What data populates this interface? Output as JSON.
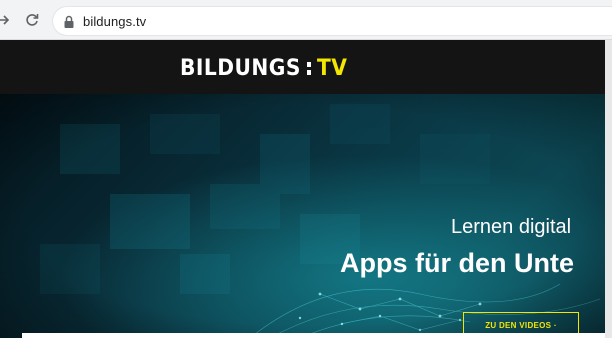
{
  "browser": {
    "url": "bildungs.tv",
    "icons": {
      "forward": "forward-arrow-icon",
      "reload": "reload-icon",
      "lock": "lock-icon"
    }
  },
  "header": {
    "logo_primary": "BILDUNGS",
    "logo_secondary": "TV"
  },
  "hero": {
    "subtitle": "Lernen digital",
    "title": "Apps für den Unte",
    "cta_label": "ZU DEN VIDEOS ·"
  },
  "colors": {
    "accent_yellow": "#f3e600",
    "header_bg": "#141414",
    "hero_dark": "#03141b",
    "hero_teal": "#0c4753",
    "chrome_bg": "#f1f3f4"
  }
}
